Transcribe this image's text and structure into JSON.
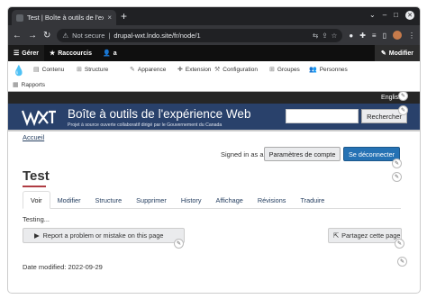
{
  "browser": {
    "tab_title": "Test | Boîte à outils de l'ex",
    "tab_close": "×",
    "new_tab": "+",
    "security": "Not secure",
    "url": "drupal-wxt.lndo.site/fr/node/1"
  },
  "drupal_toolbar": {
    "manage": "Gérer",
    "shortcuts": "Raccourcis",
    "user": "a",
    "edit": "Modifier"
  },
  "admin_tray": {
    "items": [
      "Contenu",
      "Structure",
      "Apparence",
      "Extension",
      "Configuration",
      "Groupes",
      "Personnes",
      "Rapports"
    ]
  },
  "language": {
    "toggle": "English"
  },
  "banner": {
    "title": "Boîte à outils de l'expérience Web",
    "subtitle": "Projet à source ouverte collaboratif dirigé par le Gouvernement du Canada",
    "search_button": "Rechercher"
  },
  "page": {
    "breadcrumb": "Accueil",
    "signed_in": "Signed in as a",
    "account_settings": "Paramètres de compte",
    "logout": "Se déconnecter",
    "title": "Test",
    "tabs": [
      "Voir",
      "Modifier",
      "Structure",
      "Supprimer",
      "History",
      "Affichage",
      "Révisions",
      "Traduire"
    ],
    "body": "Testing...",
    "report": "Report a problem or mistake on this page",
    "share": "Partagez cette page",
    "date_modified": "Date modified: 2022-09-29"
  },
  "colors": {
    "banner_bg": "#29416b",
    "primary_button": "#2572b4",
    "link": "#284162",
    "title_rule": "#af3c43"
  }
}
